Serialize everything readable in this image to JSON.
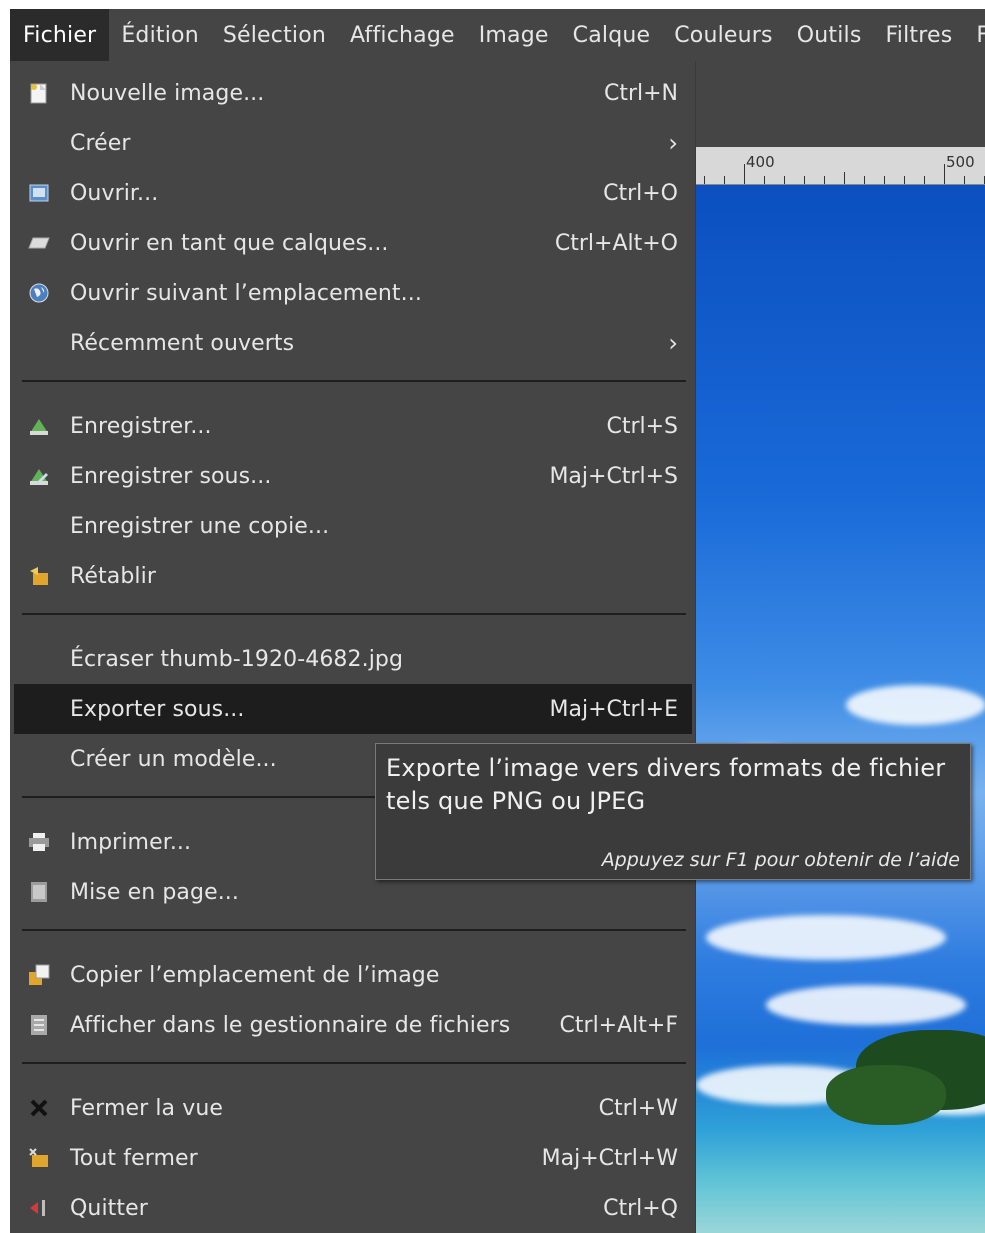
{
  "menubar": {
    "items": [
      {
        "label": "Fichier"
      },
      {
        "label": "Édition"
      },
      {
        "label": "Sélection"
      },
      {
        "label": "Affichage"
      },
      {
        "label": "Image"
      },
      {
        "label": "Calque"
      },
      {
        "label": "Couleurs"
      },
      {
        "label": "Outils"
      },
      {
        "label": "Filtres"
      },
      {
        "label": "Fené"
      }
    ]
  },
  "ruler": {
    "labels": [
      "400",
      "500"
    ]
  },
  "file_menu": {
    "items": [
      {
        "label": "Nouvelle image...",
        "shortcut": "Ctrl+N",
        "icon": "new-image-icon"
      },
      {
        "label": "Créer",
        "submenu": true
      },
      {
        "label": "Ouvrir...",
        "shortcut": "Ctrl+O",
        "icon": "open-icon"
      },
      {
        "label": "Ouvrir en tant que calques...",
        "shortcut": "Ctrl+Alt+O",
        "icon": "open-as-layers-icon"
      },
      {
        "label": "Ouvrir suivant l’emplacement...",
        "icon": "globe-icon"
      },
      {
        "label": "Récemment ouverts",
        "submenu": true
      },
      {
        "label": "Enregistrer...",
        "shortcut": "Ctrl+S",
        "icon": "save-icon"
      },
      {
        "label": "Enregistrer sous...",
        "shortcut": "Maj+Ctrl+S",
        "icon": "save-as-icon"
      },
      {
        "label": "Enregistrer une copie..."
      },
      {
        "label": "Rétablir",
        "icon": "revert-icon"
      },
      {
        "label": "Écraser thumb-1920-4682.jpg"
      },
      {
        "label": "Exporter sous...",
        "shortcut": "Maj+Ctrl+E",
        "highlighted": true
      },
      {
        "label": "Créer un modèle..."
      },
      {
        "label": "Imprimer...",
        "icon": "printer-icon"
      },
      {
        "label": "Mise en page...",
        "icon": "page-setup-icon"
      },
      {
        "label": "Copier l’emplacement de l’image",
        "icon": "copy-location-icon"
      },
      {
        "label": "Afficher dans le gestionnaire de fichiers",
        "shortcut": "Ctrl+Alt+F",
        "icon": "file-manager-icon"
      },
      {
        "label": "Fermer la vue",
        "shortcut": "Ctrl+W",
        "icon": "close-icon"
      },
      {
        "label": "Tout fermer",
        "shortcut": "Maj+Ctrl+W",
        "icon": "close-all-icon"
      },
      {
        "label": "Quitter",
        "shortcut": "Ctrl+Q",
        "icon": "quit-icon"
      }
    ]
  },
  "tooltip": {
    "line1": "Exporte l’image vers divers formats de fichier",
    "line2": "tels que PNG ou JPEG",
    "hint": "Appuyez sur F1 pour obtenir de l’aide"
  },
  "colors": {
    "menu_bg": "#454545",
    "highlight_bg": "#1d1d1d",
    "text": "#e6e6e6",
    "separator": "#1e1e1e",
    "sky": "#1a6ad9"
  }
}
